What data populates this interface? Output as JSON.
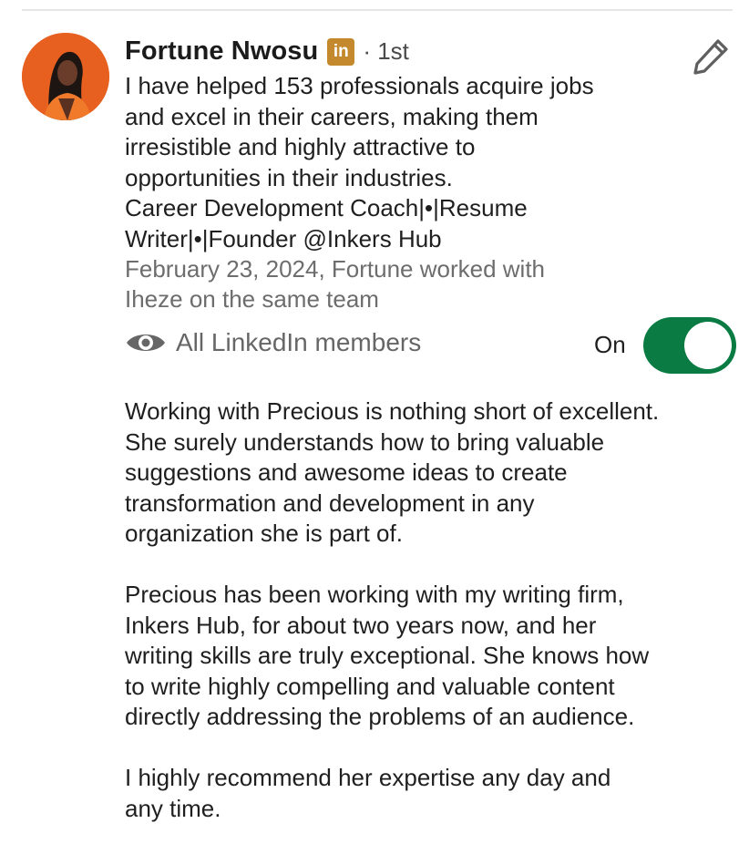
{
  "recommender": {
    "name": "Fortune Nwosu",
    "badge": "in",
    "degree": "· 1st",
    "headline_lines": [
      "I have helped 153 professionals acquire jobs\nand excel in their careers, making them\nirresistible and highly attractive to\nopportunities in their industries.\nCareer Development Coach|•|Resume\nWriter|•|Founder @Inkers Hub"
    ],
    "context": "February 23, 2024, Fortune worked with\nIheze on the same team"
  },
  "visibility": {
    "icon": "eye-icon",
    "label": "All LinkedIn members",
    "toggle_label": "On",
    "toggle_on": true,
    "toggle_color": "#0a7c43"
  },
  "recommendation": {
    "paragraphs": [
      "Working with Precious is nothing short of excellent.\nShe surely understands how to bring valuable\nsuggestions and awesome ideas to create\ntransformation and development in any\norganization she is part of.",
      "Precious has been working with my writing firm,\nInkers Hub, for about two years now, and her\nwriting skills are truly exceptional. She knows how\nto write highly compelling and valuable content\ndirectly addressing the problems of an audience.",
      "I highly recommend her expertise any day and\nany time."
    ]
  },
  "icons": {
    "edit": "pencil-icon",
    "badge": "linkedin-icon"
  },
  "colors": {
    "linkedin_badge": "#c3892c",
    "avatar_ring": "#e85a1f"
  }
}
